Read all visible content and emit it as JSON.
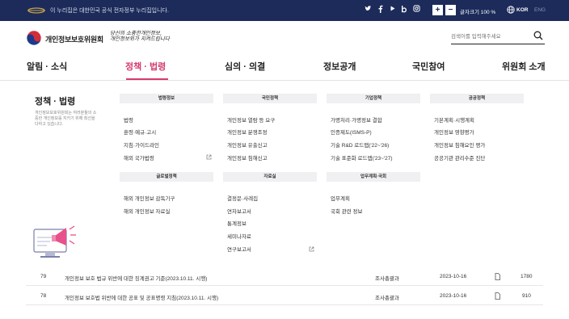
{
  "topbar": {
    "notice": "이 누리집은 대한민국 공식 전자정부 누리집입니다.",
    "sns": [
      "twitter-icon",
      "facebook-icon",
      "youtube-icon",
      "blog-icon",
      "instagram-icon"
    ],
    "zoom_in": "+",
    "zoom_out": "−",
    "zoom_label": "글자크기 100 %",
    "lang_current": "KOR",
    "lang_other": "ENG"
  },
  "header": {
    "logo_text": "개인정보보호위원회",
    "slogan_line1": "당신의 소중한개인정보,",
    "slogan_line2": "개인정보위가 지켜드립니다",
    "search_placeholder": "검색어를 입력해주세요"
  },
  "gnb": {
    "items": [
      {
        "label": "알림 · 소식"
      },
      {
        "label": "정책 · 법령"
      },
      {
        "label": "심의 · 의결"
      },
      {
        "label": "정보공개"
      },
      {
        "label": "국민참여"
      },
      {
        "label": "위원회 소개"
      }
    ]
  },
  "megamenu": {
    "title": "정책 · 법령",
    "desc": "개인정보보호위원회는 여러분들의 소중한 개인정보를 지키기 위해 최선을 다하고 있습니다.",
    "groups": [
      {
        "head": "법령정보",
        "links": [
          "법령",
          "훈령·예규·고시",
          "지침·가이드라인",
          "해외 국가법령"
        ]
      },
      {
        "head": "국민정책",
        "links": [
          "개인정보 열람 등 요구",
          "개인정보 분쟁조정",
          "개인정보 유출신고",
          "개인정보 침해신고"
        ]
      },
      {
        "head": "기업정책",
        "links": [
          "가명처리·가명정보 결합",
          "인증제도(ISMS-P)",
          "기술 R&D 로드맵('22~'26)",
          "기술 표준화 로드맵('23~'27)"
        ]
      },
      {
        "head": "공공정책",
        "links": [
          "기본계획·시행계획",
          "개인정보 영향평가",
          "개인정보 침해요인 평가",
          "공공기관 관리수준 진단"
        ]
      },
      {
        "head": "글로벌정책",
        "links": [
          "해외 개인정보 감독기구",
          "해외 개인정보 자료실"
        ]
      },
      {
        "head": "자료실",
        "links": [
          "결정문·사례집",
          "연차보고서",
          "통계정보",
          "세미나자료",
          "연구보고서"
        ]
      },
      {
        "head": "업무계획·국회",
        "links": [
          "업무계획",
          "국회 관련 정보"
        ]
      }
    ]
  },
  "table": {
    "rows": [
      {
        "no": "79",
        "title": "개인정보 보호 법규 위반에 대한 징계권고 기준(2023.10.11. 시행)",
        "dept": "조사총괄과",
        "date": "2023-10-16",
        "views": "1780"
      },
      {
        "no": "78",
        "title": "개인정보 보호법 위반에 대한 공표 및 공표명령 지침(2023.10.11. 시행)",
        "dept": "조사총괄과",
        "date": "2023-10-16",
        "views": "910"
      }
    ]
  },
  "colors": {
    "topbar": "#1c2b5a",
    "accent": "#d63b6d"
  }
}
